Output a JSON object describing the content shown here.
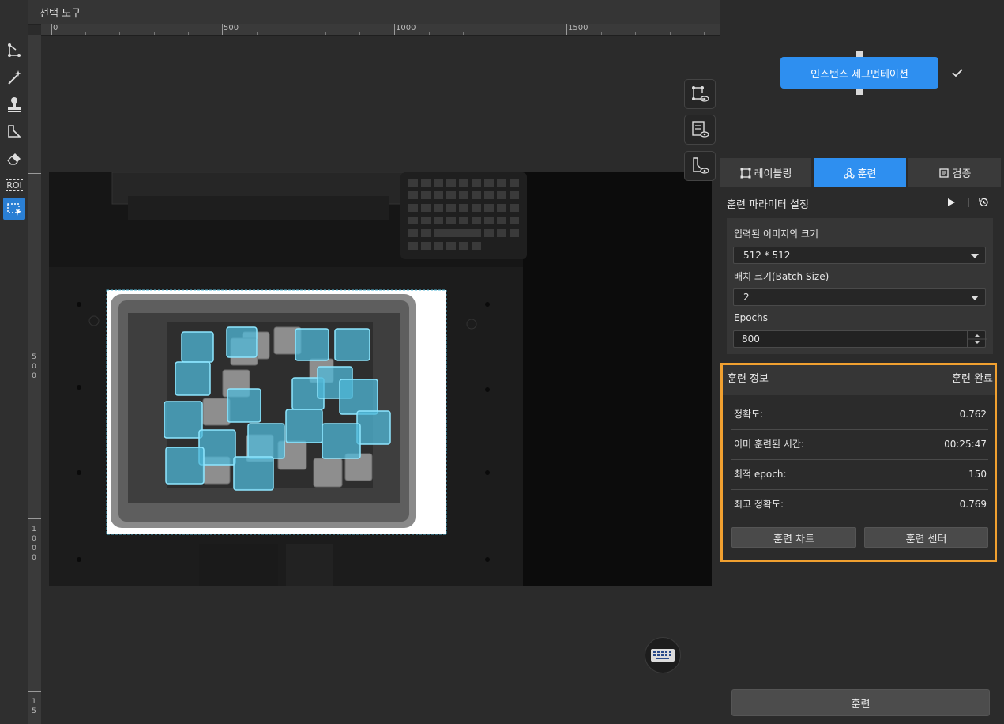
{
  "header": {
    "tool_title": "선택 도구"
  },
  "ruler": {
    "top_labels": [
      "0",
      "500",
      "1000",
      "1500"
    ],
    "left_labels": [
      "5\n0\n0",
      "1\n0\n0\n0",
      "1\n5"
    ]
  },
  "toolbar": {
    "tools": [
      {
        "name": "polygon-tool",
        "icon": "polygon-icon"
      },
      {
        "name": "magic-wand-tool",
        "icon": "magic-wand-icon"
      },
      {
        "name": "stamp-tool",
        "icon": "stamp-icon"
      },
      {
        "name": "mask-tool",
        "icon": "mask-icon"
      },
      {
        "name": "eraser-tool",
        "icon": "eraser-icon"
      },
      {
        "name": "roi-tool",
        "icon": "roi-icon",
        "label": "ROI"
      },
      {
        "name": "select-tool",
        "icon": "select-icon",
        "active": true
      }
    ]
  },
  "model": {
    "node_label": "인스턴스 세그먼테이션",
    "status_icon": "check-icon"
  },
  "tabs": [
    {
      "label": "레이블링",
      "icon": "label-icon"
    },
    {
      "label": "훈련",
      "icon": "train-icon",
      "active": true
    },
    {
      "label": "검증",
      "icon": "validate-icon"
    }
  ],
  "params": {
    "title": "훈련 파라미터 설정",
    "image_size_label": "입력된 이미지의 크기",
    "image_size_value": "512 * 512",
    "batch_label": "배치 크기(Batch Size)",
    "batch_value": "2",
    "epochs_label": "Epochs",
    "epochs_value": "800"
  },
  "info": {
    "title": "훈련 정보",
    "status": "훈련 완료",
    "rows": [
      {
        "key": "정확도:",
        "value": "0.762"
      },
      {
        "key": "이미 훈련된 시간:",
        "value": "00:25:47"
      },
      {
        "key": "최적 epoch:",
        "value": "150"
      },
      {
        "key": "최고 정확도:",
        "value": "0.769"
      }
    ],
    "chart_button": "훈련 차트",
    "center_button": "훈련 센터"
  },
  "train_button": "훈련",
  "colors": {
    "accent": "#2e8ff0",
    "highlight": "#f0a030",
    "annotation": "#4fb8d8"
  }
}
